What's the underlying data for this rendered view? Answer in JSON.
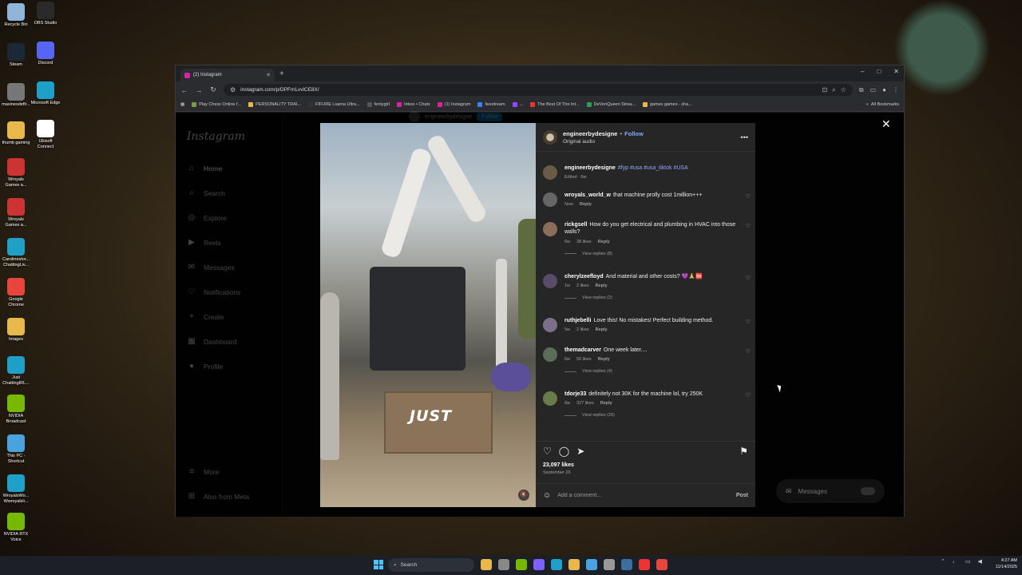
{
  "desktop": {
    "icons": [
      {
        "label": "Recycle Bin",
        "icon": "recycle-bin-icon",
        "color": "#8fb6d9"
      },
      {
        "label": "OBS Studio",
        "icon": "obs-icon",
        "color": "#2a2a2a"
      },
      {
        "label": "Steam",
        "icon": "steam-icon",
        "color": "#1b2838"
      },
      {
        "label": "Discord",
        "icon": "discord-icon",
        "color": "#5865f2"
      },
      {
        "label": "maxinesdeflr...",
        "icon": "image-file-icon",
        "color": "#777"
      },
      {
        "label": "Microsoft Edge",
        "icon": "edge-icon",
        "color": "#1fa0c8"
      },
      {
        "label": "thumb gaming",
        "icon": "folder-icon",
        "color": "#e8b84a"
      },
      {
        "label": "Ubisoft Connect",
        "icon": "ubisoft-icon",
        "color": "#ffffff"
      },
      {
        "label": "Wroyals Games a...",
        "icon": "pdf-icon",
        "color": "#c33"
      },
      {
        "label": "Wroyals Games a...",
        "icon": "pdf-icon",
        "color": "#c33"
      },
      {
        "label": "Carolinestor... ChattingLiv...",
        "icon": "edge-icon",
        "color": "#1fa0c8"
      },
      {
        "label": "Google Chrome",
        "icon": "chrome-icon",
        "color": "#e8453c"
      },
      {
        "label": "Images",
        "icon": "folder-icon",
        "color": "#e8b84a"
      },
      {
        "label": "Just ChattingIRL...",
        "icon": "edge-icon",
        "color": "#1fa0c8"
      },
      {
        "label": "NVIDIA Broadcast",
        "icon": "nvidia-icon",
        "color": "#76b900"
      },
      {
        "label": "This PC - Shortcut",
        "icon": "pc-icon",
        "color": "#4aa3df"
      },
      {
        "label": "WroyalsWo... Wwroyalsli...",
        "icon": "edge-icon",
        "color": "#1fa0c8"
      },
      {
        "label": "NVIDIA RTX Voice",
        "icon": "headset-icon",
        "color": "#76b900"
      }
    ]
  },
  "browser": {
    "tab_title": "(2) Instagram",
    "new_tab": "+",
    "url": "instagram.com/p/DPFmLvvlCE8X/",
    "bookmarks": [
      {
        "label": "Play Chess Online f...",
        "color": "#7a9a4a"
      },
      {
        "label": "PERSONALITY TRAI...",
        "color": "#e8b84a"
      },
      {
        "label": "FIFURE Lsama Ultra...",
        "color": "#333"
      },
      {
        "label": "fentygirl",
        "color": "#555"
      },
      {
        "label": "Inbox • Chats",
        "color": "#d6249f"
      },
      {
        "label": "(1) Instagram",
        "color": "#d6249f"
      },
      {
        "label": "livestream",
        "color": "#3b82f6"
      },
      {
        "label": "...",
        "color": "#9146ff"
      },
      {
        "label": "The Best Of The Int...",
        "color": "#e33"
      },
      {
        "label": "DeVenQueen Strea...",
        "color": "#2e9e4e"
      },
      {
        "label": "games games - sha...",
        "color": "#e8b84a"
      }
    ],
    "all_bookmarks": "All Bookmarks"
  },
  "instagram": {
    "logo": "Instagram",
    "nav": [
      {
        "label": "Home",
        "icon": "home-icon",
        "glyph": "⌂",
        "active": true
      },
      {
        "label": "Search",
        "icon": "search-icon",
        "glyph": "⌕"
      },
      {
        "label": "Explore",
        "icon": "compass-icon",
        "glyph": "◎"
      },
      {
        "label": "Reels",
        "icon": "reels-icon",
        "glyph": "▶"
      },
      {
        "label": "Messages",
        "icon": "messenger-icon",
        "glyph": "✉"
      },
      {
        "label": "Notifications",
        "icon": "heart-icon",
        "glyph": "♡"
      },
      {
        "label": "Create",
        "icon": "plus-icon",
        "glyph": "+"
      },
      {
        "label": "Dashboard",
        "icon": "dashboard-icon",
        "glyph": "▦"
      },
      {
        "label": "Profile",
        "icon": "profile-icon",
        "glyph": "●"
      },
      {
        "label": "More",
        "icon": "menu-icon",
        "glyph": "≡"
      },
      {
        "label": "Also from Meta",
        "icon": "meta-icon",
        "glyph": "⊞"
      }
    ],
    "bg_header": {
      "user": "engineerbydesigne",
      "follow": "Follow"
    }
  },
  "post": {
    "video_overlay_text": "JUST",
    "header": {
      "username": "engineerbydesigne",
      "separator": "•",
      "follow": "Follow",
      "subtitle": "Original audio"
    },
    "comments": [
      {
        "user": "engineerbydesigne",
        "text": "",
        "tags": "#fyp #usa #usa_tiktok #USA",
        "meta": [
          "Edited · 6w"
        ],
        "replies": "",
        "heart": false
      },
      {
        "user": "wroyals_world_w",
        "text": "that machine prolly cost 1million+++",
        "tags": "",
        "meta": [
          "Now",
          "Reply"
        ],
        "replies": "",
        "heart": true
      },
      {
        "user": "rickgsell",
        "text": "How do you get electrical and plumbing in HVAC into those walls?",
        "tags": "",
        "meta": [
          "6w",
          "38 likes",
          "Reply"
        ],
        "replies": "View replies (8)",
        "heart": true
      },
      {
        "user": "cherylzeefloyd",
        "text": "And material and other costs? 💜🙏🆘",
        "tags": "",
        "meta": [
          "1w",
          "2 likes",
          "Reply"
        ],
        "replies": "View replies (2)",
        "heart": true
      },
      {
        "user": "ruthjebelli",
        "text": "Love this! No mistakes! Perfect building method.",
        "tags": "",
        "meta": [
          "5w",
          "2 likes",
          "Reply"
        ],
        "replies": "",
        "heart": true
      },
      {
        "user": "themadcarver",
        "text": "One week later....",
        "tags": "",
        "meta": [
          "6w",
          "56 likes",
          "Reply"
        ],
        "replies": "View replies (4)",
        "heart": true
      },
      {
        "user": "tdorje33",
        "text": "definitely not 30K for the machine lol, try 250K",
        "tags": "",
        "meta": [
          "6w",
          "327 likes",
          "Reply"
        ],
        "replies": "View replies (20)",
        "heart": true
      }
    ],
    "likes": "23,097 likes",
    "date": "September 26",
    "comment_placeholder": "Add a comment...",
    "post_label": "Post"
  },
  "messages_pill": "Messages",
  "taskbar": {
    "search_placeholder": "Search",
    "apps": [
      {
        "icon": "file-explorer-icon",
        "color": "#e8b84a"
      },
      {
        "icon": "task-view-icon",
        "color": "#888"
      },
      {
        "icon": "headset-icon",
        "color": "#76b900"
      },
      {
        "icon": "copilot-icon",
        "color": "#7b61ff"
      },
      {
        "icon": "edge-icon",
        "color": "#1fa0c8"
      },
      {
        "icon": "folder-icon",
        "color": "#e8b84a"
      },
      {
        "icon": "store-icon",
        "color": "#4aa3df"
      },
      {
        "icon": "settings-icon",
        "color": "#999"
      },
      {
        "icon": "steam-icon",
        "color": "#3b6fa0"
      },
      {
        "icon": "snipping-icon",
        "color": "#e33"
      },
      {
        "icon": "chrome-icon",
        "color": "#e8453c"
      }
    ],
    "time": "4:27 AM",
    "date": "11/14/2025"
  }
}
